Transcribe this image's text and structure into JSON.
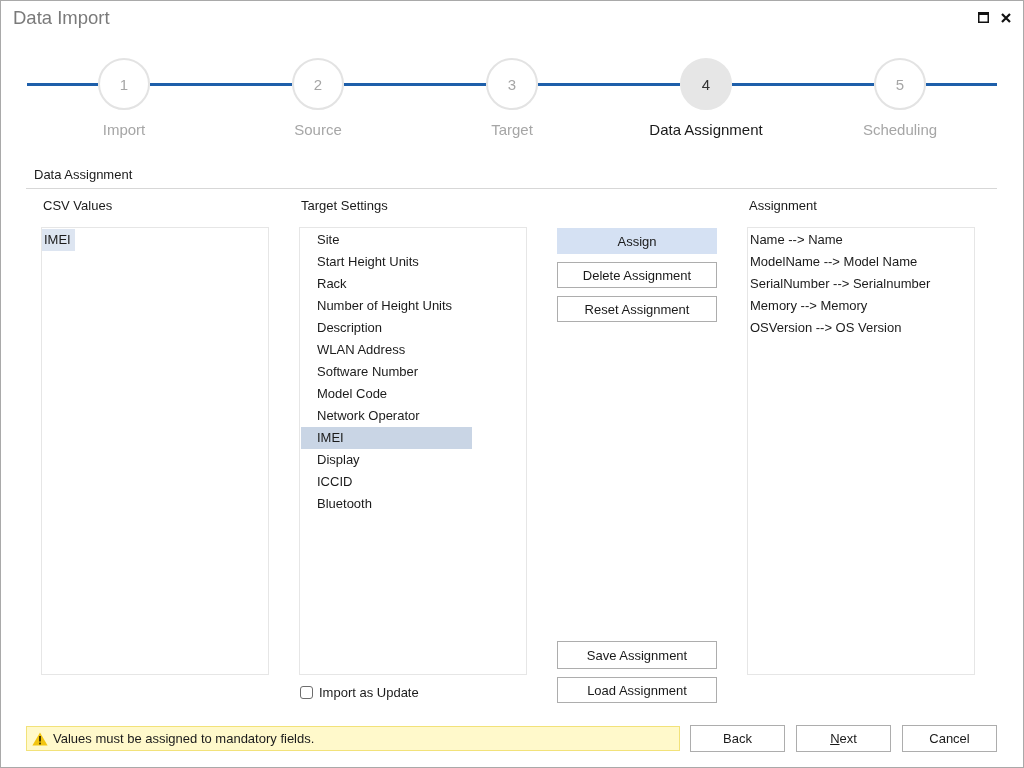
{
  "window": {
    "title": "Data Import"
  },
  "steps": [
    {
      "number": "1",
      "label": "Import",
      "selected": false
    },
    {
      "number": "2",
      "label": "Source",
      "selected": false
    },
    {
      "number": "3",
      "label": "Target",
      "selected": false
    },
    {
      "number": "4",
      "label": "Data Assignment",
      "selected": true
    },
    {
      "number": "5",
      "label": "Scheduling",
      "selected": false
    }
  ],
  "section_title": "Data Assignment",
  "csv_values": {
    "heading": "CSV Values",
    "items": [
      {
        "label": "IMEI",
        "selected": true
      }
    ]
  },
  "target_settings": {
    "heading": "Target Settings",
    "items": [
      {
        "label": "Site",
        "selected": false
      },
      {
        "label": "Start Height Units",
        "selected": false
      },
      {
        "label": "Rack",
        "selected": false
      },
      {
        "label": "Number of Height Units",
        "selected": false
      },
      {
        "label": "Description",
        "selected": false
      },
      {
        "label": "WLAN Address",
        "selected": false
      },
      {
        "label": "Software Number",
        "selected": false
      },
      {
        "label": "Model Code",
        "selected": false
      },
      {
        "label": "Network Operator",
        "selected": false
      },
      {
        "label": "IMEI",
        "selected": true
      },
      {
        "label": "Display",
        "selected": false
      },
      {
        "label": "ICCID",
        "selected": false
      },
      {
        "label": "Bluetooth",
        "selected": false
      }
    ]
  },
  "import_as_update": {
    "label": "Import as Update",
    "checked": false
  },
  "actions": {
    "top": [
      {
        "label": "Assign",
        "highlighted": true
      },
      {
        "label": "Delete Assignment",
        "highlighted": false
      },
      {
        "label": "Reset Assignment",
        "highlighted": false
      }
    ],
    "bottom": [
      {
        "label": "Save Assignment",
        "highlighted": false
      },
      {
        "label": "Load Assignment",
        "highlighted": false
      }
    ]
  },
  "assignment": {
    "heading": "Assignment",
    "items": [
      {
        "label": "Name --> Name",
        "selected": false
      },
      {
        "label": "ModelName --> Model Name",
        "selected": false
      },
      {
        "label": "SerialNumber --> Serialnumber",
        "selected": false
      },
      {
        "label": "Memory --> Memory",
        "selected": false
      },
      {
        "label": "OSVersion --> OS Version",
        "selected": false
      }
    ]
  },
  "status_message": {
    "kind": "warning",
    "text": "Values must be assigned to mandatory fields."
  },
  "footer_buttons": [
    {
      "label": "Back",
      "mnemonic_underlined": false
    },
    {
      "label": "Next",
      "mnemonic_underlined": true
    },
    {
      "label": "Cancel",
      "mnemonic_underlined": false
    }
  ]
}
